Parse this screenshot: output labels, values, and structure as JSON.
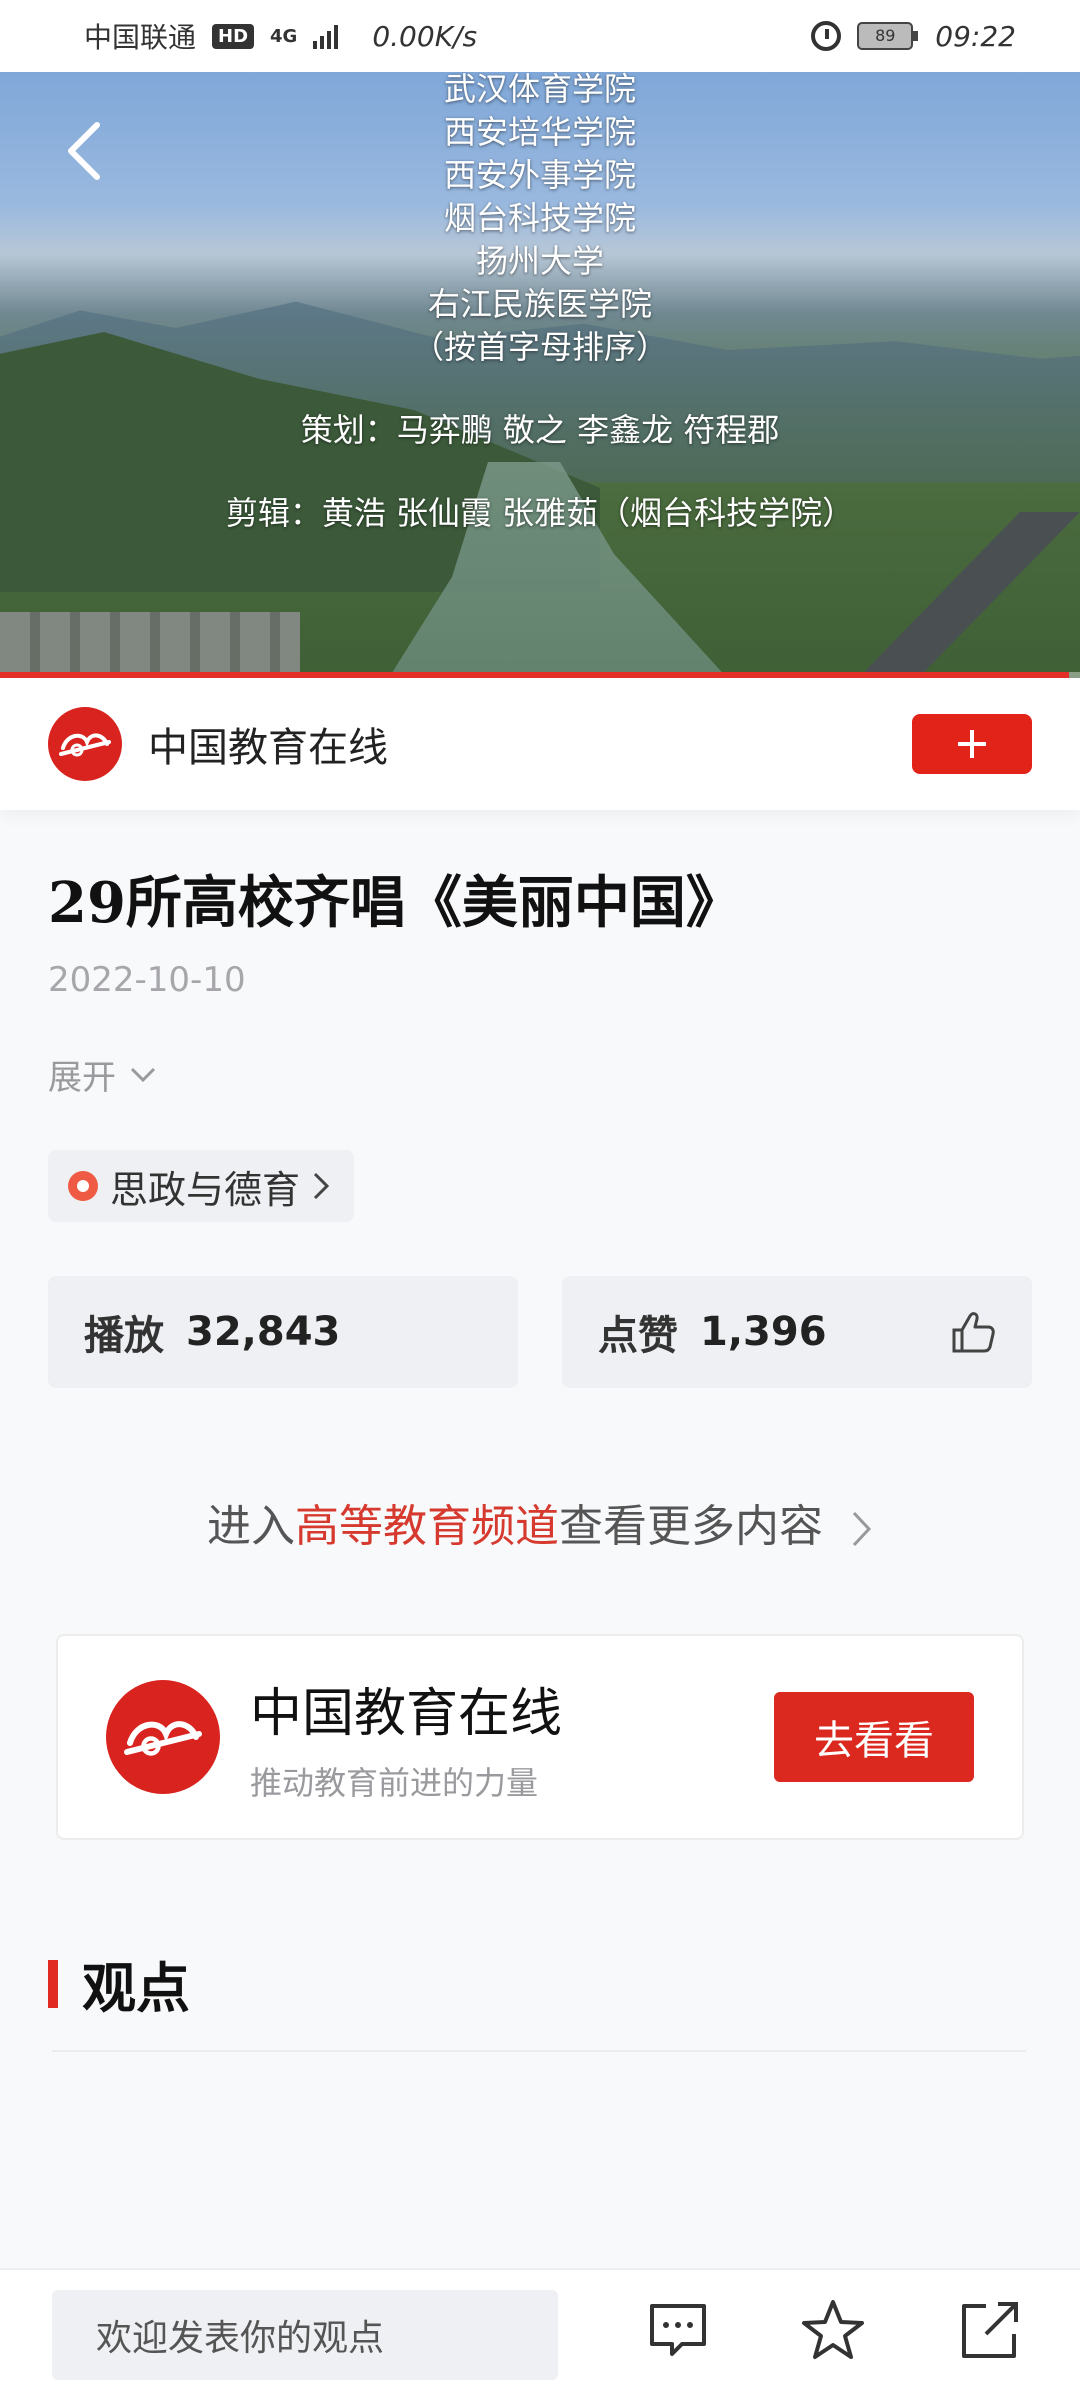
{
  "status_bar": {
    "carrier": "中国联通",
    "hd_badge": "HD",
    "network": "4G",
    "speed": "0.00K/s",
    "battery": "89",
    "time": "09:22"
  },
  "video": {
    "credits_lines": [
      "武汉体育学院",
      "西安培华学院",
      "西安外事学院",
      "烟台科技学院",
      "扬州大学",
      "右江民族医学院",
      "（按首字母排序）"
    ],
    "planning": "策划：马弈鹏  敬之  李鑫龙  符程郡",
    "editing": "剪辑：黄浩  张仙霞  张雅茹（烟台科技学院）",
    "progress": 0.99
  },
  "publisher": {
    "name": "中国教育在线",
    "follow_icon": "plus-icon"
  },
  "article": {
    "title": "29所高校齐唱《美丽中国》",
    "date": "2022-10-10",
    "expand_label": "展开",
    "topic": "思政与德育"
  },
  "stats": {
    "play_label": "播放",
    "play_count": "32,843",
    "like_label": "点赞",
    "like_count": "1,396"
  },
  "channel_link": {
    "prefix": "进入",
    "highlight": "高等教育频道",
    "suffix": "查看更多内容"
  },
  "promo": {
    "title": "中国教育在线",
    "subtitle": "推动教育前进的力量",
    "button": "去看看"
  },
  "section": {
    "title": "观点"
  },
  "bottom_bar": {
    "comment_placeholder": "欢迎发表你的观点"
  },
  "colors": {
    "accent": "#e2231a",
    "highlight_text": "#d63a2f",
    "muted": "#a7a7ab"
  }
}
